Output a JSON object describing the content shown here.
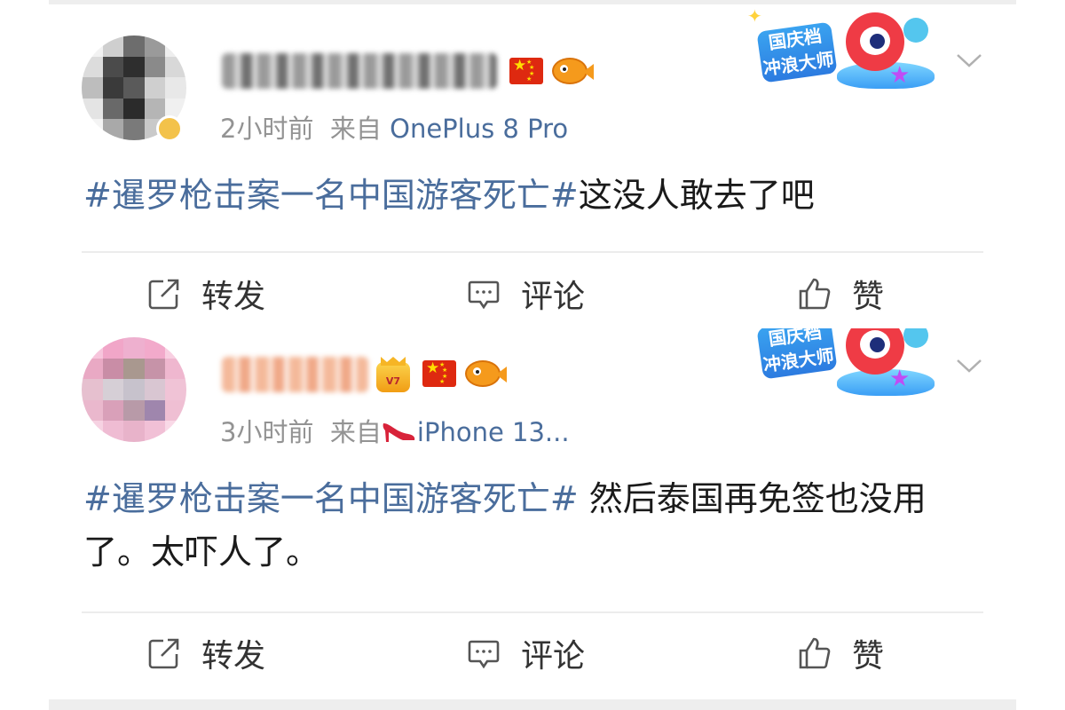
{
  "posts": [
    {
      "time": "2小时前",
      "source_prefix": "来自",
      "device": "OnePlus 8 Pro",
      "hashtag": "#暹罗枪击案一名中国游客死亡#",
      "text": "这没人敢去了吧",
      "banner_text": "国庆档 冲浪大师",
      "actions": {
        "repost": "转发",
        "comment": "评论",
        "like": "赞"
      }
    },
    {
      "time": "3小时前",
      "source_prefix": "来自",
      "device": "iPhone 13...",
      "hashtag": "#暹罗枪击案一名中国游客死亡#",
      "text": " 然后泰国再免签也没用了。太吓人了。",
      "banner_text": "国庆档 冲浪大师",
      "actions": {
        "repost": "转发",
        "comment": "评论",
        "like": "赞"
      }
    }
  ],
  "colors": {
    "link": "#4a6d9c",
    "meta": "#939393",
    "text": "#1a1a1a",
    "divider": "#ececec"
  },
  "icons": [
    "flag-cn-icon",
    "fish-emoji-icon",
    "crown-badge-icon",
    "high-heel-icon",
    "chevron-down-icon",
    "repost-icon",
    "comment-icon",
    "like-icon"
  ]
}
